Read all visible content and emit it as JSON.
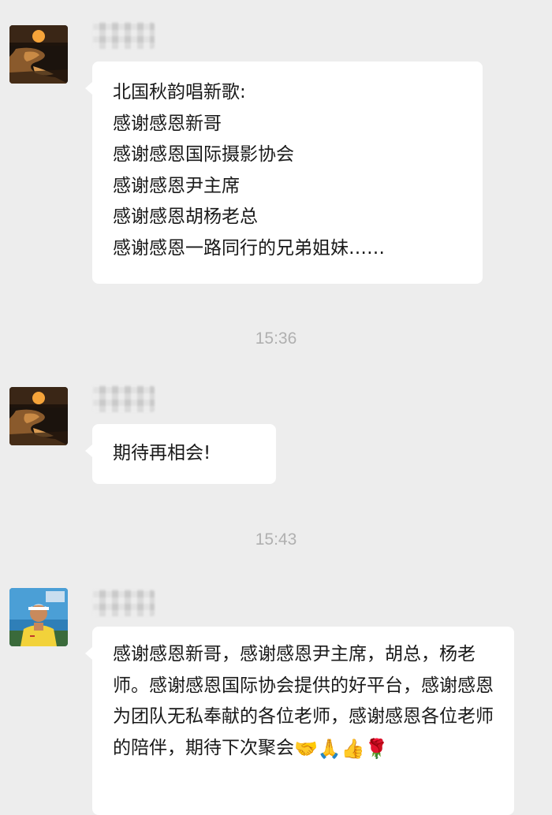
{
  "messages": [
    {
      "sender": "",
      "lines": [
        "北国秋韵唱新歌:",
        "感谢感恩新哥",
        "感谢感恩国际摄影协会",
        "感谢感恩尹主席",
        "感谢感恩胡杨老总",
        "感谢感恩一路同行的兄弟姐妹……"
      ]
    },
    {
      "timestamp": "15:36"
    },
    {
      "sender": "",
      "lines": [
        "期待再相会!"
      ]
    },
    {
      "timestamp": "15:43"
    },
    {
      "sender": "",
      "text": "感谢感恩新哥，感谢感恩尹主席，胡总，杨老师。感谢感恩国际协会提供的好平台，感谢感恩为团队无私奉献的各位老师，感谢感恩各位老师的陪伴，期待下次聚会",
      "emojis": [
        "🤝",
        "🙏",
        "👍",
        "🌹"
      ]
    }
  ],
  "icons": {
    "avatar_1": "sunset-avatar",
    "avatar_2": "sunset-avatar",
    "avatar_3": "golfer-avatar"
  },
  "colors": {
    "background": "#ededed",
    "bubble": "#ffffff",
    "timestamp": "#b0b0b0"
  }
}
